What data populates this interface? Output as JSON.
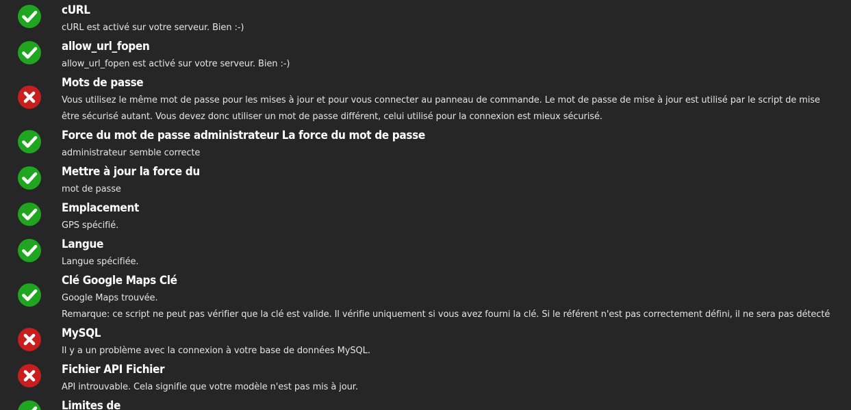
{
  "checks": [
    {
      "status": "ok",
      "icon": "check-circle-icon",
      "title": "cURL",
      "lines": [
        "cURL est activé sur votre serveur. Bien :-)"
      ]
    },
    {
      "status": "ok",
      "icon": "check-circle-icon",
      "title": "allow_url_fopen",
      "lines": [
        "allow_url_fopen est activé sur votre serveur. Bien :-)"
      ]
    },
    {
      "status": "error",
      "icon": "error-circle-icon",
      "title": "Mots de passe",
      "lines": [
        "Vous utilisez le même mot de passe pour les mises à jour et pour vous connecter au panneau de commande. Le mot de passe de mise à jour est utilisé par le script de mise",
        "être sécurisé autant. Vous devez donc utiliser un mot de passe différent, celui utilisé pour la connexion est mieux sécurisé."
      ]
    },
    {
      "status": "ok",
      "icon": "check-circle-icon",
      "title": "Force du mot de passe administrateur La force du mot de passe",
      "lines": [
        "administrateur semble correcte"
      ]
    },
    {
      "status": "ok",
      "icon": "check-circle-icon",
      "title": "Mettre à jour la force du",
      "lines": [
        "mot de passe"
      ]
    },
    {
      "status": "ok",
      "icon": "check-circle-icon",
      "title": "Emplacement",
      "lines": [
        "GPS spécifié."
      ]
    },
    {
      "status": "ok",
      "icon": "check-circle-icon",
      "title": "Langue",
      "lines": [
        "Langue spécifiée."
      ]
    },
    {
      "status": "ok",
      "icon": "check-circle-icon",
      "title": "Clé Google Maps Clé",
      "lines": [
        "Google Maps trouvée.",
        "Remarque: ce script ne peut pas vérifier que la clé est valide. Il vérifie uniquement si vous avez fourni la clé. Si le référent n'est pas correctement défini, il ne sera pas détecté"
      ]
    },
    {
      "status": "error",
      "icon": "error-circle-icon",
      "title": "MySQL",
      "lines": [
        "Il y a un problème avec la connexion à votre base de données MySQL."
      ]
    },
    {
      "status": "error",
      "icon": "error-circle-icon",
      "title": "Fichier API Fichier",
      "lines": [
        "API introuvable. Cela signifie que votre modèle n'est pas mis à jour."
      ]
    },
    {
      "status": "ok",
      "icon": "check-circle-icon",
      "title": "Limites de",
      "lines": []
    }
  ],
  "colors": {
    "ok": "#1fa51f",
    "error": "#c81e1e",
    "background": "#262626",
    "text": "#e4e4e4"
  }
}
